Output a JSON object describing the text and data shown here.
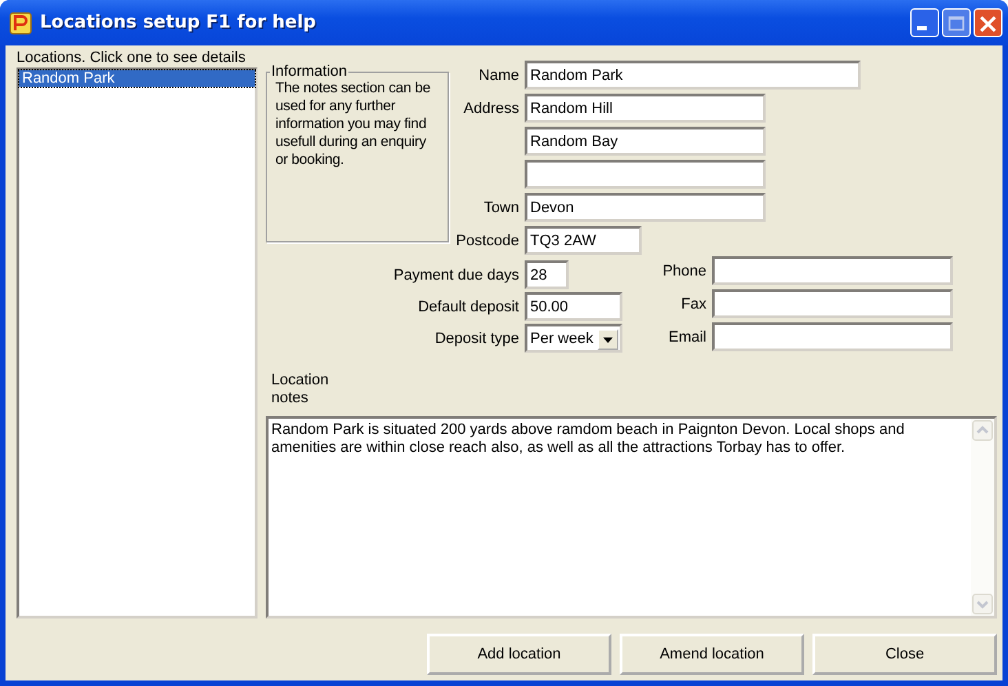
{
  "window": {
    "title": "Locations setup F1 for help"
  },
  "locations": {
    "label": "Locations.  Click one to see details",
    "items": [
      {
        "name": "Random Park",
        "selected": true
      }
    ]
  },
  "information": {
    "title": "Information",
    "text": "The notes section can be used for any further information you may find usefull during an enquiry or booking."
  },
  "address_fields": [
    {
      "label": "Name",
      "value": "Random Park",
      "kind": "text"
    },
    {
      "label": "Address",
      "value": "Random Hill",
      "kind": "text"
    },
    {
      "value": "Random Bay",
      "kind": "text"
    },
    {
      "kind": "text"
    },
    {
      "label": "Town",
      "value": "Devon",
      "kind": "text"
    },
    {
      "label": "Postcode",
      "value": "TQ3 2AW",
      "kind": "text"
    }
  ],
  "booking_fields": [
    {
      "label": "Payment due days",
      "value": "28",
      "kind": "text"
    },
    {
      "label": "Default deposit",
      "value": "50.00",
      "kind": "text"
    },
    {
      "label": "Deposit type",
      "value": "Per week",
      "kind": "dropdown"
    }
  ],
  "contact_fields": [
    {
      "label": "Phone"
    },
    {
      "label": "Fax"
    },
    {
      "label": "Email"
    }
  ],
  "notes": {
    "label": "Location notes",
    "value": "Random Park is situated 200 yards above ramdom beach in Paignton Devon.  Local shops and amenities are within close reach also, as well as all the attractions Torbay has to offer."
  },
  "buttons": [
    "Add location",
    "Amend location",
    "Close"
  ]
}
